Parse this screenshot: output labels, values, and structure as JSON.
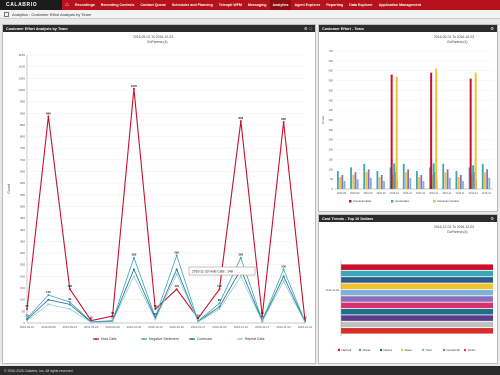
{
  "app": {
    "logo": "CALABRIO",
    "home_icon": "home-icon"
  },
  "nav": [
    "Recordings",
    "Recording Controls",
    "Contact Queue",
    "Scheduler and Planning",
    "Teleopti WFM",
    "Messaging",
    "Analytics",
    "Agent Explorer",
    "Reporting",
    "Data Explorer",
    "Application Management"
  ],
  "nav_active": "Analytics",
  "breadcrumb": "Analytics : Customer Effort Analysis by Team",
  "footer": "© 2006-2025 Calabrio, Inc. All rights reserved.",
  "colors": {
    "brand": "#b5121b",
    "holds": "#c8102e",
    "negative": "#3aa6b9",
    "confusion": "#1f6f8b",
    "repeat": "#8fd1d8"
  },
  "panels": {
    "main": {
      "title": "Customer Effort Analysis by Team",
      "daterange": "2016-09-01 To 2016-10-03",
      "subtitle": "GoParena (4)",
      "tooltip": "2016-11-23 Hold Calls : 148"
    },
    "effort_team": {
      "title": "Customer Effort - Team",
      "daterange": "2016-09-01 To 2016-10-03",
      "subtitle": "GoParena (4)"
    },
    "cost_trends": {
      "title": "Cost Trends - Top 10 Dollars",
      "daterange": "2016-12-03 To 2016-12-03",
      "subtitle": "GoParena (4)"
    }
  },
  "chart_data": [
    {
      "type": "line",
      "ylabel": "Count",
      "ylim": [
        0,
        1150
      ],
      "yticks": [
        0,
        50,
        100,
        150,
        200,
        250,
        300,
        350,
        400,
        450,
        500,
        550,
        600,
        650,
        700,
        750,
        800,
        850,
        900,
        950,
        1000,
        1050,
        1100,
        1150
      ],
      "x": [
        "2016-09-01",
        "2016-09-08",
        "2016-09-15",
        "2016-09-22",
        "2016-09-29",
        "2016-10-06",
        "2016-10-13",
        "2016-10-20",
        "2016-10-27",
        "2016-11-03",
        "2016-11-10",
        "2016-11-17",
        "2016-11-24",
        "2016-12-01"
      ],
      "series": [
        {
          "name": "Hold Calls",
          "values": [
            60,
            886,
            146,
            10,
            30,
            1005,
            60,
            145,
            20,
            145,
            866,
            30,
            862,
            10
          ]
        },
        {
          "name": "Negative Sentiment",
          "values": [
            20,
            120,
            90,
            5,
            10,
            280,
            25,
            290,
            8,
            85,
            280,
            10,
            230,
            5
          ]
        },
        {
          "name": "Confusion",
          "values": [
            15,
            100,
            80,
            4,
            8,
            230,
            20,
            230,
            6,
            70,
            230,
            8,
            200,
            4
          ]
        },
        {
          "name": "Repeat Calls",
          "values": [
            10,
            80,
            60,
            3,
            6,
            200,
            15,
            210,
            5,
            60,
            200,
            6,
            180,
            3
          ]
        }
      ]
    },
    {
      "type": "bar",
      "ylabel": "Count",
      "categories": [
        "2016-09",
        "2016-09",
        "2016-09",
        "2016-09",
        "2016-10",
        "2016-10",
        "2016-10",
        "2016-11",
        "2016-11",
        "2016-11",
        "2016-12",
        "2016-12"
      ],
      "series": [
        {
          "name": "American East",
          "values": [
            0,
            0,
            0,
            0,
            580,
            0,
            0,
            590,
            0,
            0,
            560,
            0
          ]
        },
        {
          "name": "Amsterdam",
          "values": [
            0,
            0,
            0,
            0,
            130,
            0,
            0,
            130,
            0,
            0,
            120,
            0
          ]
        },
        {
          "name": "American Central",
          "values": [
            0,
            0,
            0,
            0,
            570,
            0,
            0,
            610,
            0,
            0,
            590,
            0
          ]
        }
      ]
    },
    {
      "type": "bar",
      "orientation": "horizontal",
      "categories": [
        "2016-12-03"
      ],
      "series": [
        {
          "name": "Hartnell",
          "values": [
            100
          ]
        },
        {
          "name": "Olivas",
          "values": [
            100
          ]
        },
        {
          "name": "Davies",
          "values": [
            100
          ]
        },
        {
          "name": "Vasco",
          "values": [
            100
          ]
        },
        {
          "name": "Trent",
          "values": [
            100
          ]
        },
        {
          "name": "Goodsmith",
          "values": [
            100
          ]
        },
        {
          "name": "Tonkin",
          "values": [
            100
          ]
        }
      ]
    }
  ]
}
